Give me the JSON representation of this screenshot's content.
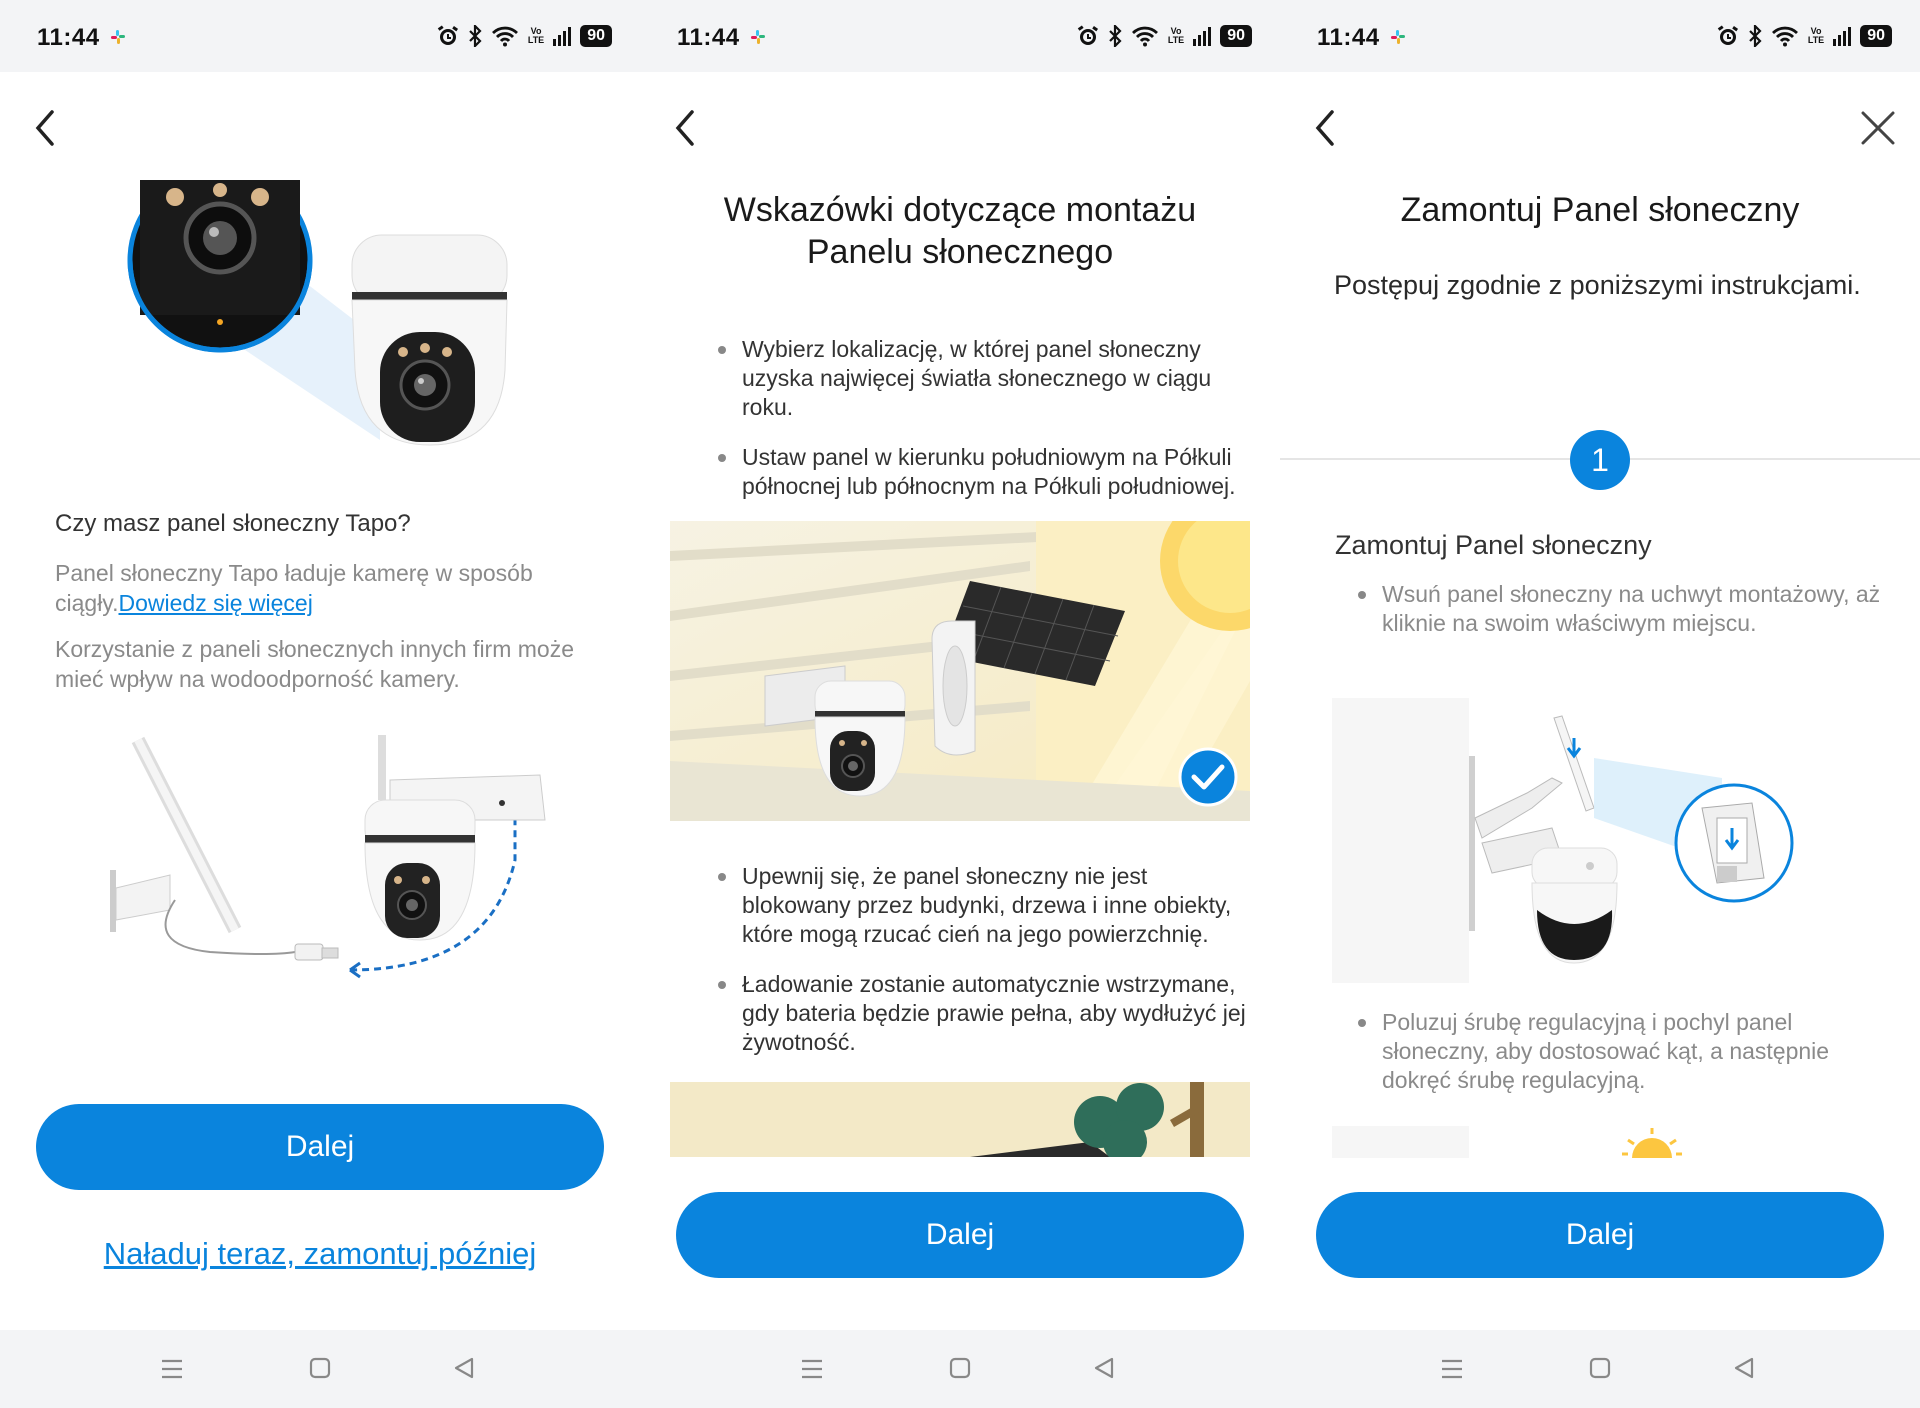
{
  "status_bar": {
    "time": "11:44",
    "battery": "90",
    "volte_top": "Vo",
    "volte_bottom": "LTE"
  },
  "screen1": {
    "question": "Czy masz panel słoneczny Tapo?",
    "description": "Panel słoneczny Tapo ładuje kamerę w sposób ciągły.",
    "learn_more": "Dowiedz się więcej",
    "note": "Korzystanie z paneli słonecznych innych firm może mieć wpływ na wodoodporność kamery.",
    "next_button": "Dalej",
    "later_link": "Naładuj teraz, zamontuj później"
  },
  "screen2": {
    "title_line1": "Wskazówki dotyczące montażu",
    "title_line2": "Panelu słonecznego",
    "bullets": [
      "Wybierz lokalizację, w której panel słoneczny uzyska najwięcej światła słonecznego w ciągu roku.",
      "Ustaw panel w kierunku południowym na Półkuli północnej lub północnym na Półkuli południowej.",
      "Upewnij się, że panel słoneczny nie jest blokowany przez budynki, drzewa i inne obiekty, które mogą rzucać cień na jego powierzchnię.",
      "Ładowanie zostanie automatycznie wstrzymane, gdy bateria będzie prawie pełna, aby wydłużyć jej żywotność."
    ],
    "next_button": "Dalej"
  },
  "screen3": {
    "title": "Zamontuj Panel słoneczny",
    "subtitle": "Postępuj zgodnie z poniższymi instrukcjami.",
    "step_number": "1",
    "step_title": "Zamontuj Panel słoneczny",
    "bullets": [
      "Wsuń panel słoneczny na uchwyt montażowy, aż kliknie na swoim właściwym miejscu.",
      "Poluzuj śrubę regulacyjną i pochyl panel słoneczny, aby dostosować kąt, a następnie dokręć śrubę regulacyjną."
    ],
    "next_button": "Dalej"
  },
  "colors": {
    "accent": "#0a84dd",
    "statusbar_bg": "#f3f4f6",
    "muted_text": "#8a8a8a"
  }
}
